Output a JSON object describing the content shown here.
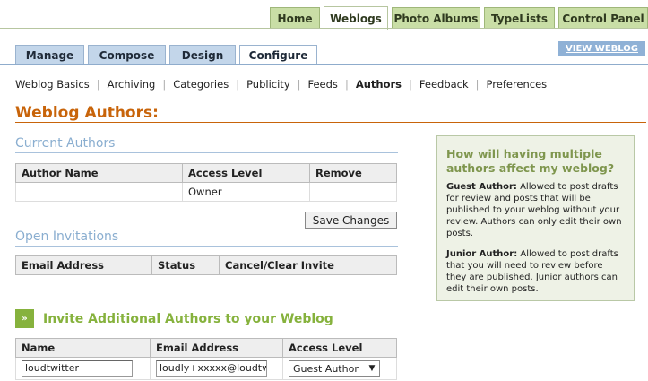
{
  "top_tabs": [
    "Home",
    "Weblogs",
    "Photo Albums",
    "TypeLists",
    "Control Panel"
  ],
  "sub_tabs": [
    "Manage",
    "Compose",
    "Design",
    "Configure"
  ],
  "view_weblog": "VIEW WEBLOG",
  "sec_nav": [
    "Weblog Basics",
    "Archiving",
    "Categories",
    "Publicity",
    "Feeds",
    "Authors",
    "Feedback",
    "Preferences"
  ],
  "page_title": "Weblog Authors:",
  "current_authors": {
    "title": "Current Authors",
    "headers": [
      "Author Name",
      "Access Level",
      "Remove"
    ],
    "rows": [
      [
        "",
        "Owner",
        ""
      ]
    ],
    "save_label": "Save Changes"
  },
  "open_invitations": {
    "title": "Open Invitations",
    "headers": [
      "Email Address",
      "Status",
      "Cancel/Clear Invite"
    ]
  },
  "sidebox": {
    "heading": "How will having multiple authors affect my weblog?",
    "guest_label": "Guest Author:",
    "guest_text": "Allowed to post drafts for review and posts that will be published to your weblog without your review. Authors can only edit their own posts.",
    "junior_label": "Junior Author:",
    "junior_text": "Allowed to post drafts that you will need to review before they are published. Junior authors can edit their own posts."
  },
  "invite": {
    "arrow": "»",
    "title": "Invite Additional Authors to your Weblog",
    "headers": [
      "Name",
      "Email Address",
      "Access Level"
    ],
    "name_value": "loudtwitter",
    "email_value": "loudly+xxxxx@loudtw",
    "access_value": "Guest Author"
  }
}
